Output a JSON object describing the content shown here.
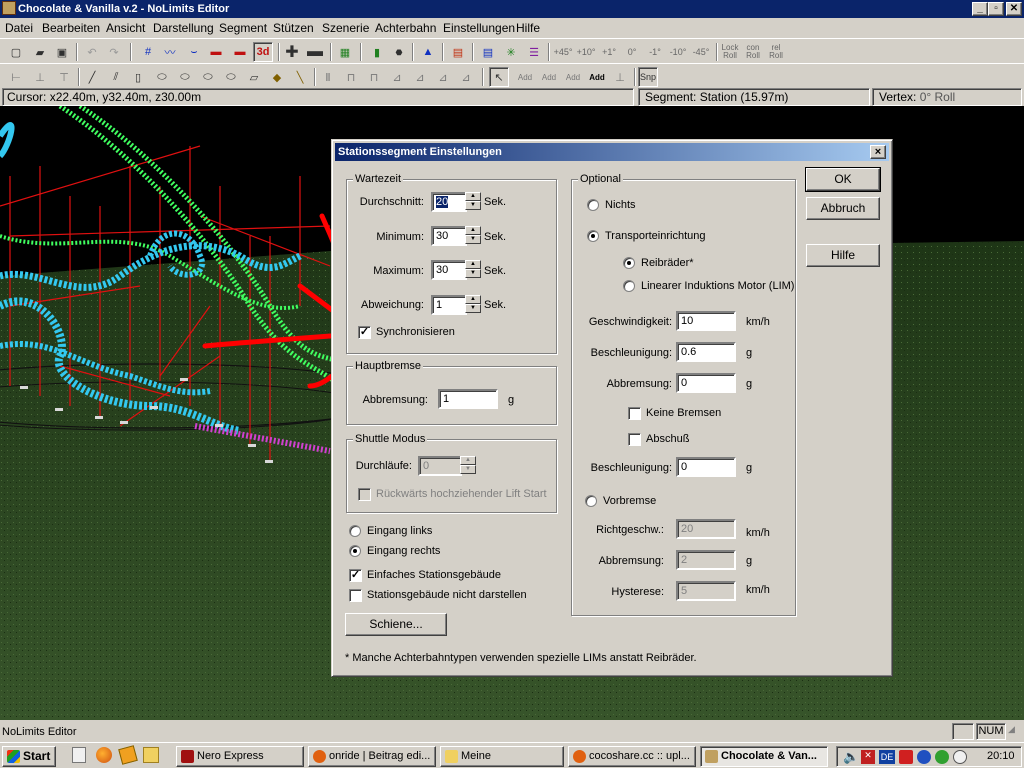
{
  "window": {
    "title": "Chocolate & Vanilla v.2 - NoLimits Editor",
    "min": "_",
    "max": "▫",
    "close": "✕"
  },
  "menu": [
    "Datei",
    "Bearbeiten",
    "Ansicht",
    "Darstellung",
    "Segment",
    "Stützen",
    "Szenerie",
    "Achterbahn",
    "Einstellungen",
    "Hilfe"
  ],
  "toolbar": {
    "labels": [
      "+45°",
      "+10°",
      "+1°",
      "0°",
      "-1°",
      "-10°",
      "-45°",
      "Lock Roll",
      "con Roll",
      "rel Roll",
      "Snp",
      "Add",
      "Add",
      "Add",
      "Add"
    ],
    "d3": "3d"
  },
  "status": {
    "cursor_label": "Cursor:",
    "cursor_value": "x22.40m, y32.40m, z30.00m",
    "segment_label": "Segment:",
    "segment_value": "Station (15.97m)",
    "vertex_label": "Vertex:",
    "vertex_value": "0° Roll"
  },
  "dialog": {
    "title": "Stationssegment Einstellungen",
    "close": "×",
    "wartezeit": {
      "title": "Wartezeit",
      "durchschnitt_label": "Durchschnitt:",
      "durchschnitt": "20",
      "minimum_label": "Minimum:",
      "minimum": "30",
      "maximum_label": "Maximum:",
      "maximum": "30",
      "abweichung_label": "Abweichung:",
      "abweichung": "1",
      "unit": "Sek.",
      "sync_label": "Synchronisieren",
      "sync_checked": true
    },
    "hauptbremse": {
      "title": "Hauptbremse",
      "abbremsung_label": "Abbremsung:",
      "abbremsung": "1",
      "unit": "g"
    },
    "shuttle": {
      "title": "Shuttle Modus",
      "durchlaeufe_label": "Durchläufe:",
      "durchlaeufe": "0",
      "lift_label": "Rückwärts hochziehender Lift Start"
    },
    "eingang_links": "Eingang links",
    "eingang_rechts": "Eingang rechts",
    "einfach_label": "Einfaches Stationsgebäude",
    "nicht_darstellen_label": "Stationsgebäude nicht darstellen",
    "schiene_button": "Schiene...",
    "optional": {
      "title": "Optional",
      "nichts": "Nichts",
      "transport": "Transporteinrichtung",
      "reibraeder": "Reibräder*",
      "lim": "Linearer Induktions Motor (LIM)",
      "geschw_label": "Geschwindigkeit:",
      "geschw": "10",
      "geschw_unit": "km/h",
      "beschl_label": "Beschleunigung:",
      "beschl": "0.6",
      "g_unit": "g",
      "abbrems_label": "Abbremsung:",
      "abbrems": "0",
      "keine_bremsen": "Keine Bremsen",
      "abschuss": "Abschuß",
      "beschl2_label": "Beschleunigung:",
      "beschl2": "0",
      "vorbremse": "Vorbremse",
      "richt_label": "Richtgeschw.:",
      "richt": "20",
      "abbrems2_label": "Abbremsung:",
      "abbrems2": "2",
      "hyst_label": "Hysterese:",
      "hyst": "5"
    },
    "ok": "OK",
    "abbruch": "Abbruch",
    "hilfe": "Hilfe",
    "footnote": "* Manche Achterbahntypen verwenden spezielle LIMs anstatt Reibräder."
  },
  "bottom_status": {
    "text": "NoLimits Editor",
    "num": "NUM"
  },
  "taskbar": {
    "start": "Start",
    "tasks": [
      "Nero Express",
      "onride | Beitrag edi...",
      "Meine",
      "cocoshare.cc :: upl...",
      "Chocolate & Van..."
    ],
    "lang": "DE",
    "clock": "20:10"
  },
  "colors": {
    "title_blue": "#0a246a",
    "coaster_cyan": "#33c8f0",
    "coaster_green": "#40ff60",
    "support_red": "#e01010",
    "ground_green": "#2e4a20",
    "annotation_red": "#ff0000"
  }
}
